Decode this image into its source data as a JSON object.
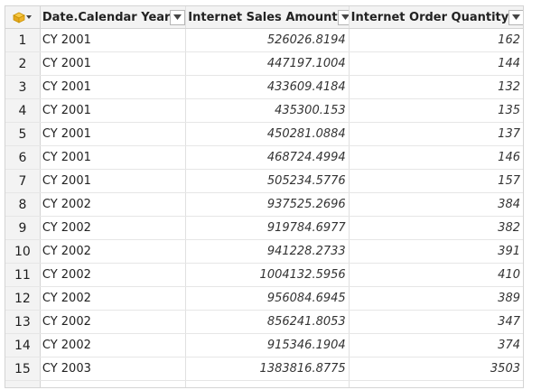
{
  "columns": [
    {
      "label": "Date.Calendar Year"
    },
    {
      "label": "Internet Sales Amount"
    },
    {
      "label": "Internet Order Quantity"
    }
  ],
  "rows": [
    {
      "idx": "1",
      "year": "CY 2001",
      "sales": "526026.8194",
      "qty": "162"
    },
    {
      "idx": "2",
      "year": "CY 2001",
      "sales": "447197.1004",
      "qty": "144"
    },
    {
      "idx": "3",
      "year": "CY 2001",
      "sales": "433609.4184",
      "qty": "132"
    },
    {
      "idx": "4",
      "year": "CY 2001",
      "sales": "435300.153",
      "qty": "135"
    },
    {
      "idx": "5",
      "year": "CY 2001",
      "sales": "450281.0884",
      "qty": "137"
    },
    {
      "idx": "6",
      "year": "CY 2001",
      "sales": "468724.4994",
      "qty": "146"
    },
    {
      "idx": "7",
      "year": "CY 2001",
      "sales": "505234.5776",
      "qty": "157"
    },
    {
      "idx": "8",
      "year": "CY 2002",
      "sales": "937525.2696",
      "qty": "384"
    },
    {
      "idx": "9",
      "year": "CY 2002",
      "sales": "919784.6977",
      "qty": "382"
    },
    {
      "idx": "10",
      "year": "CY 2002",
      "sales": "941228.2733",
      "qty": "391"
    },
    {
      "idx": "11",
      "year": "CY 2002",
      "sales": "1004132.5956",
      "qty": "410"
    },
    {
      "idx": "12",
      "year": "CY 2002",
      "sales": "956084.6945",
      "qty": "389"
    },
    {
      "idx": "13",
      "year": "CY 2002",
      "sales": "856241.8053",
      "qty": "347"
    },
    {
      "idx": "14",
      "year": "CY 2002",
      "sales": "915346.1904",
      "qty": "374"
    },
    {
      "idx": "15",
      "year": "CY 2003",
      "sales": "1383816.8775",
      "qty": "3503"
    }
  ],
  "colors": {
    "header_bg": "#f3f3f3",
    "table_icon": "#f0b429"
  },
  "icons": {
    "table_menu": "table-icon",
    "filter": "dropdown-filter-icon"
  }
}
